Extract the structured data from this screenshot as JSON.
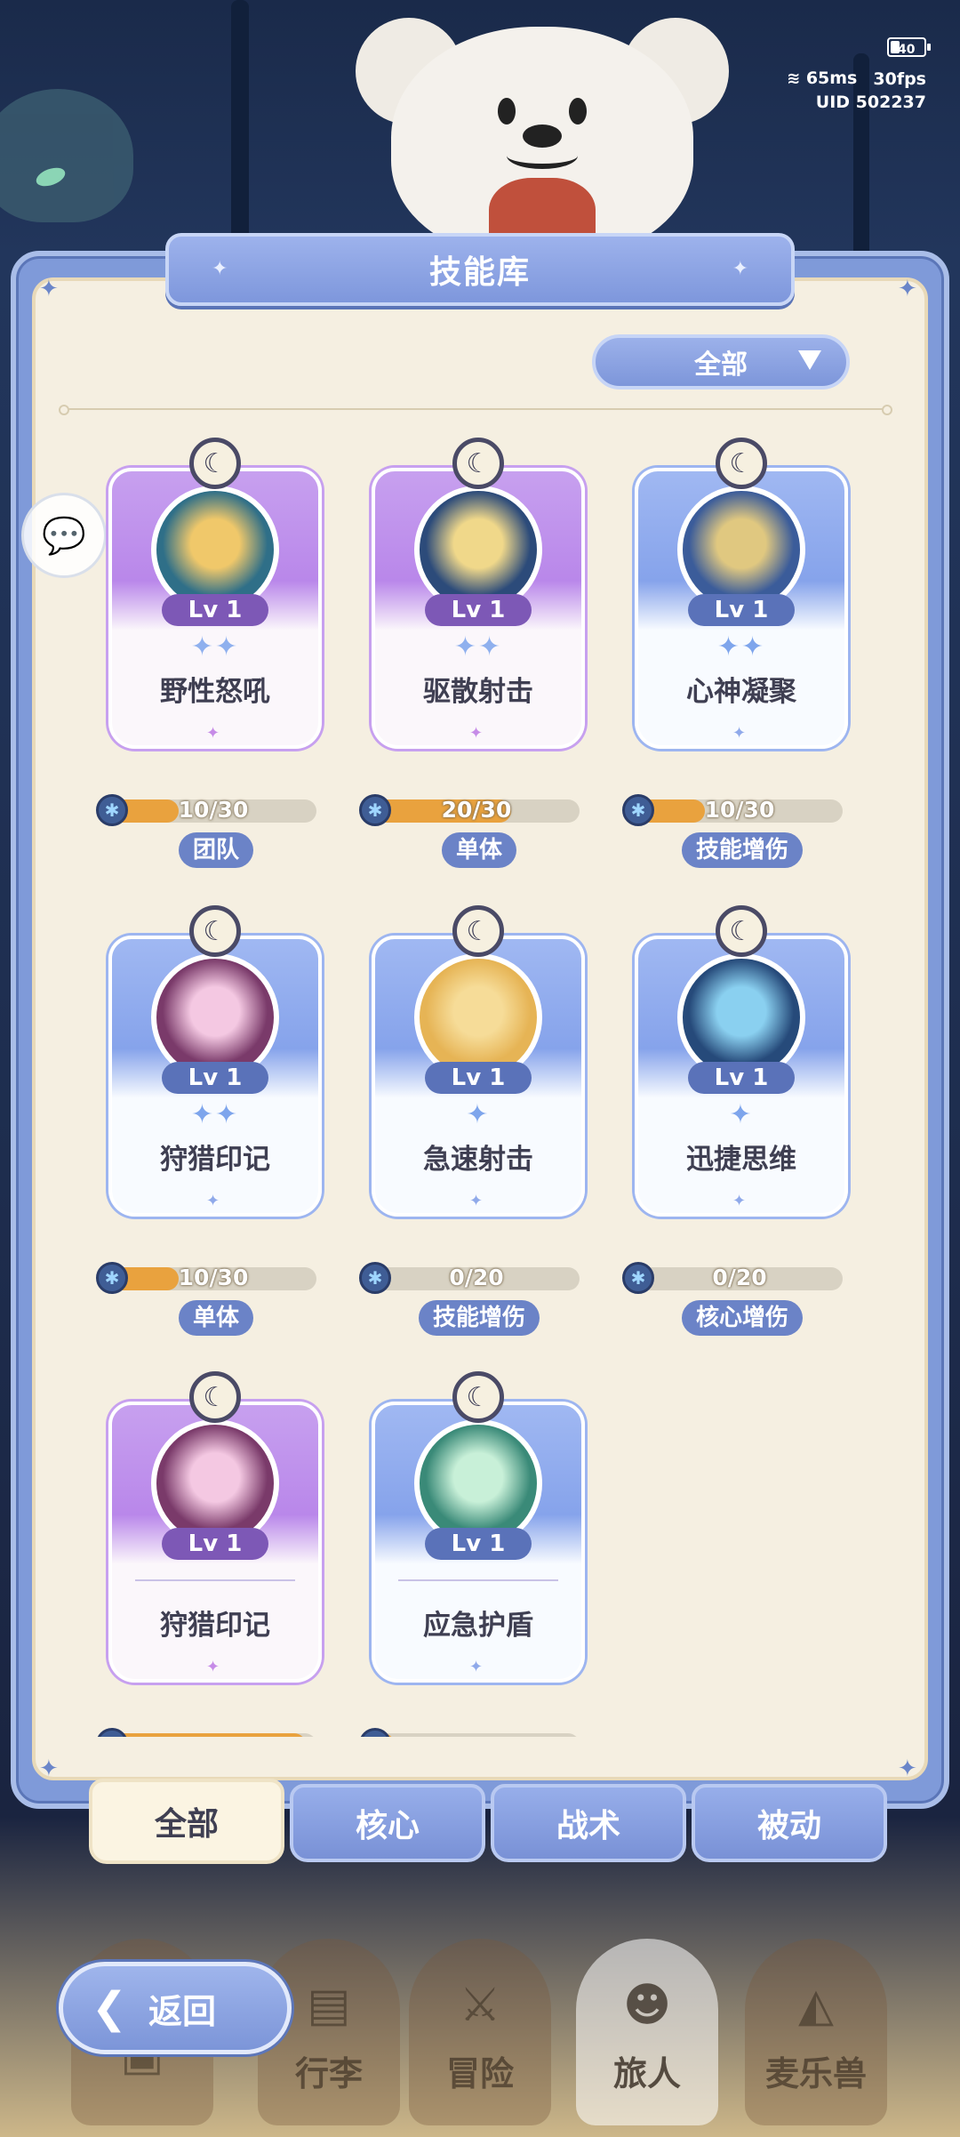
{
  "status": {
    "battery": "40",
    "ping": "65ms",
    "fps": "30fps",
    "uid": "UID 502237"
  },
  "panel": {
    "title": "技能库"
  },
  "filter": {
    "selected": "全部"
  },
  "cards": [
    {
      "name": "野性怒吼",
      "level": "Lv 1",
      "stars": "✦✦",
      "color": "purple",
      "progress": "10/30",
      "progress_value": 0.33,
      "tag": "团队"
    },
    {
      "name": "驱散射击",
      "level": "Lv 1",
      "stars": "✦✦",
      "color": "purple",
      "progress": "20/30",
      "progress_value": 0.67,
      "tag": "单体"
    },
    {
      "name": "心神凝聚",
      "level": "Lv 1",
      "stars": "✦✦",
      "color": "blue",
      "progress": "10/30",
      "progress_value": 0.33,
      "tag": "技能增伤"
    },
    {
      "name": "狩猎印记",
      "level": "Lv 1",
      "stars": "✦✦",
      "color": "blue",
      "progress": "10/30",
      "progress_value": 0.33,
      "tag": "单体"
    },
    {
      "name": "急速射击",
      "level": "Lv 1",
      "stars": "✦",
      "color": "blue",
      "progress": "0/20",
      "progress_value": 0,
      "tag": "技能增伤"
    },
    {
      "name": "迅捷思维",
      "level": "Lv 1",
      "stars": "✦",
      "color": "blue",
      "progress": "0/20",
      "progress_value": 0,
      "tag": "核心增伤"
    },
    {
      "name": "狩猎印记",
      "level": "Lv 1",
      "stars": "",
      "color": "purple",
      "progress": "",
      "progress_value": 0.95,
      "tag": ""
    },
    {
      "name": "应急护盾",
      "level": "Lv 1",
      "stars": "",
      "color": "blue",
      "progress": "",
      "progress_value": 0.1,
      "tag": ""
    }
  ],
  "tabs": [
    "全部",
    "核心",
    "战术",
    "被动"
  ],
  "nav": [
    "行李",
    "冒险",
    "旅人",
    "麦乐兽"
  ],
  "back": {
    "label": "返回"
  },
  "colors": {
    "panel_blue": "#7f9ad9",
    "purple_card": "#b987ea",
    "blue_card": "#86a3eb",
    "progress_orange": "#e9a23e",
    "tag_blue": "#6b83c7"
  },
  "icons": {
    "crest": "moon-crest-icon",
    "gem": "gem-icon",
    "chat": "chat-bubble-icon",
    "back": "back-arrow-icon"
  }
}
